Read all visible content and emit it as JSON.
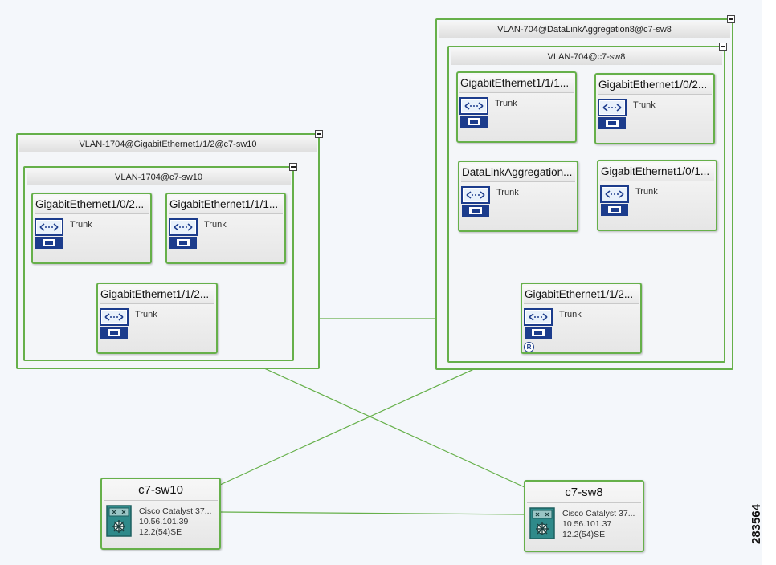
{
  "groups": {
    "left_outer": "VLAN-1704@GigabitEthernet1/1/2@c7-sw10",
    "left_inner": "VLAN-1704@c7-sw10",
    "right_outer": "VLAN-704@DataLinkAggregation8@c7-sw8",
    "right_inner": "VLAN-704@c7-sw8"
  },
  "interfaces": {
    "l1": {
      "name": "GigabitEthernet1/0/2...",
      "type": "Trunk"
    },
    "l2": {
      "name": "GigabitEthernet1/1/1...",
      "type": "Trunk"
    },
    "l3": {
      "name": "GigabitEthernet1/1/2...",
      "type": "Trunk"
    },
    "r1": {
      "name": "GigabitEthernet1/1/1...",
      "type": "Trunk"
    },
    "r2": {
      "name": "GigabitEthernet1/0/2...",
      "type": "Trunk"
    },
    "r3": {
      "name": "DataLinkAggregation...",
      "type": "Trunk"
    },
    "r4": {
      "name": "GigabitEthernet1/0/1...",
      "type": "Trunk"
    },
    "r5": {
      "name": "GigabitEthernet1/1/2...",
      "type": "Trunk",
      "badge": "R"
    }
  },
  "devices": {
    "sw10": {
      "name": "c7-sw10",
      "model": "Cisco Catalyst 37...",
      "ip": "10.56.101.39",
      "version": "12.2(54)SE"
    },
    "sw8": {
      "name": "c7-sw8",
      "model": "Cisco Catalyst 37...",
      "ip": "10.56.101.37",
      "version": "12.2(54)SE"
    }
  },
  "figure_id": "283564",
  "icons": {
    "interface": "trunk-port-icon",
    "device": "switch-icon",
    "role": "root-bridge-badge"
  },
  "colors": {
    "link": "#66b04a",
    "border": "#66b04a",
    "icon_blue": "#1c3c8c"
  }
}
